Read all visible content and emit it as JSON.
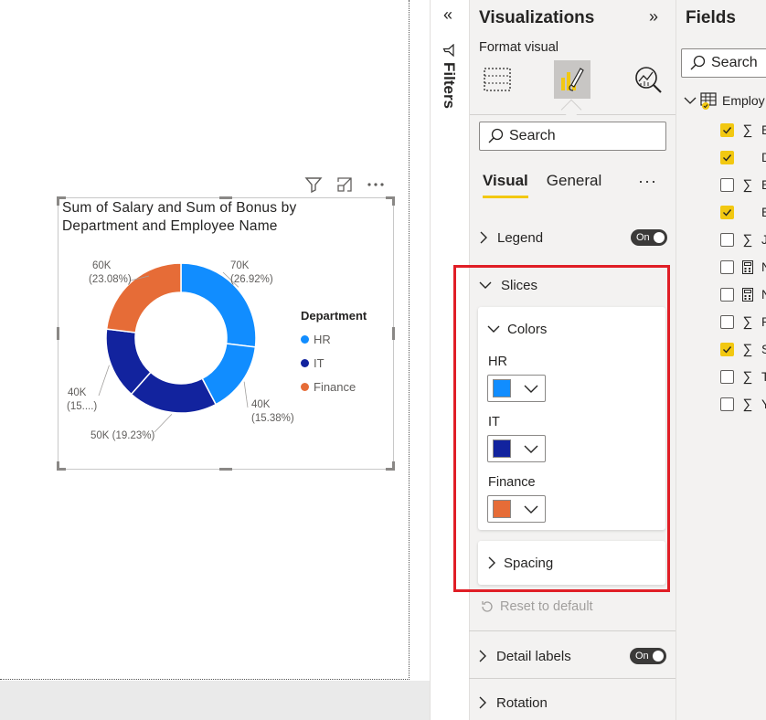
{
  "visual": {
    "title": "Sum of Salary and Sum of Bonus by Department and Employee Name",
    "legend_title": "Department",
    "legend_items": [
      {
        "label": "HR",
        "color": "#118dff"
      },
      {
        "label": "IT",
        "color": "#12239e"
      },
      {
        "label": "Finance",
        "color": "#e66c37"
      }
    ],
    "slice_labels": [
      {
        "value": "70K",
        "pct": "(26.92%)"
      },
      {
        "value": "40K",
        "pct": "(15.38%)"
      },
      {
        "value": "50K (19.23%)",
        "pct": ""
      },
      {
        "value": "40K",
        "pct": "(15....)"
      },
      {
        "value": "60K",
        "pct": "(23.08%)"
      }
    ]
  },
  "chart_data": {
    "type": "pie",
    "title": "Sum of Salary and Sum of Bonus by Department and Employee Name",
    "legend_title": "Department",
    "categories": [
      "HR",
      "HR",
      "IT",
      "IT",
      "Finance"
    ],
    "values": [
      70000,
      40000,
      50000,
      40000,
      60000
    ],
    "percentages": [
      26.92,
      15.38,
      19.23,
      15.38,
      23.08
    ],
    "colors": [
      "#118dff",
      "#118dff",
      "#12239e",
      "#12239e",
      "#e66c37"
    ],
    "donut": true,
    "legend_position": "right"
  },
  "filters": {
    "label": "Filters"
  },
  "viz": {
    "title": "Visualizations",
    "subtitle": "Format visual",
    "search_placeholder": "Search",
    "tabs": [
      "Visual",
      "General"
    ],
    "legend_label": "Legend",
    "legend_toggle": "On",
    "slices_label": "Slices",
    "colors_label": "Colors",
    "color_items": [
      {
        "label": "HR",
        "color": "#118dff"
      },
      {
        "label": "IT",
        "color": "#12239e"
      },
      {
        "label": "Finance",
        "color": "#e66c37"
      }
    ],
    "spacing_label": "Spacing",
    "reset_label": "Reset to default",
    "detail_labels_label": "Detail labels",
    "detail_labels_toggle": "On",
    "rotation_label": "Rotation"
  },
  "fields": {
    "title": "Fields",
    "search_placeholder": "Search",
    "table_name": "Employ",
    "items": [
      {
        "letter": "E",
        "checked": true,
        "sigma": true
      },
      {
        "letter": "D",
        "checked": true,
        "sigma": false
      },
      {
        "letter": "E",
        "checked": false,
        "sigma": true
      },
      {
        "letter": "E",
        "checked": true,
        "sigma": false
      },
      {
        "letter": "J",
        "checked": false,
        "sigma": true
      },
      {
        "letter": "N",
        "checked": false,
        "calc": true
      },
      {
        "letter": "N",
        "checked": false,
        "calc": true
      },
      {
        "letter": "P",
        "checked": false,
        "sigma": true
      },
      {
        "letter": "S",
        "checked": true,
        "sigma": true
      },
      {
        "letter": "T",
        "checked": false,
        "sigma": true
      },
      {
        "letter": "Y",
        "checked": false,
        "sigma": true
      }
    ]
  }
}
